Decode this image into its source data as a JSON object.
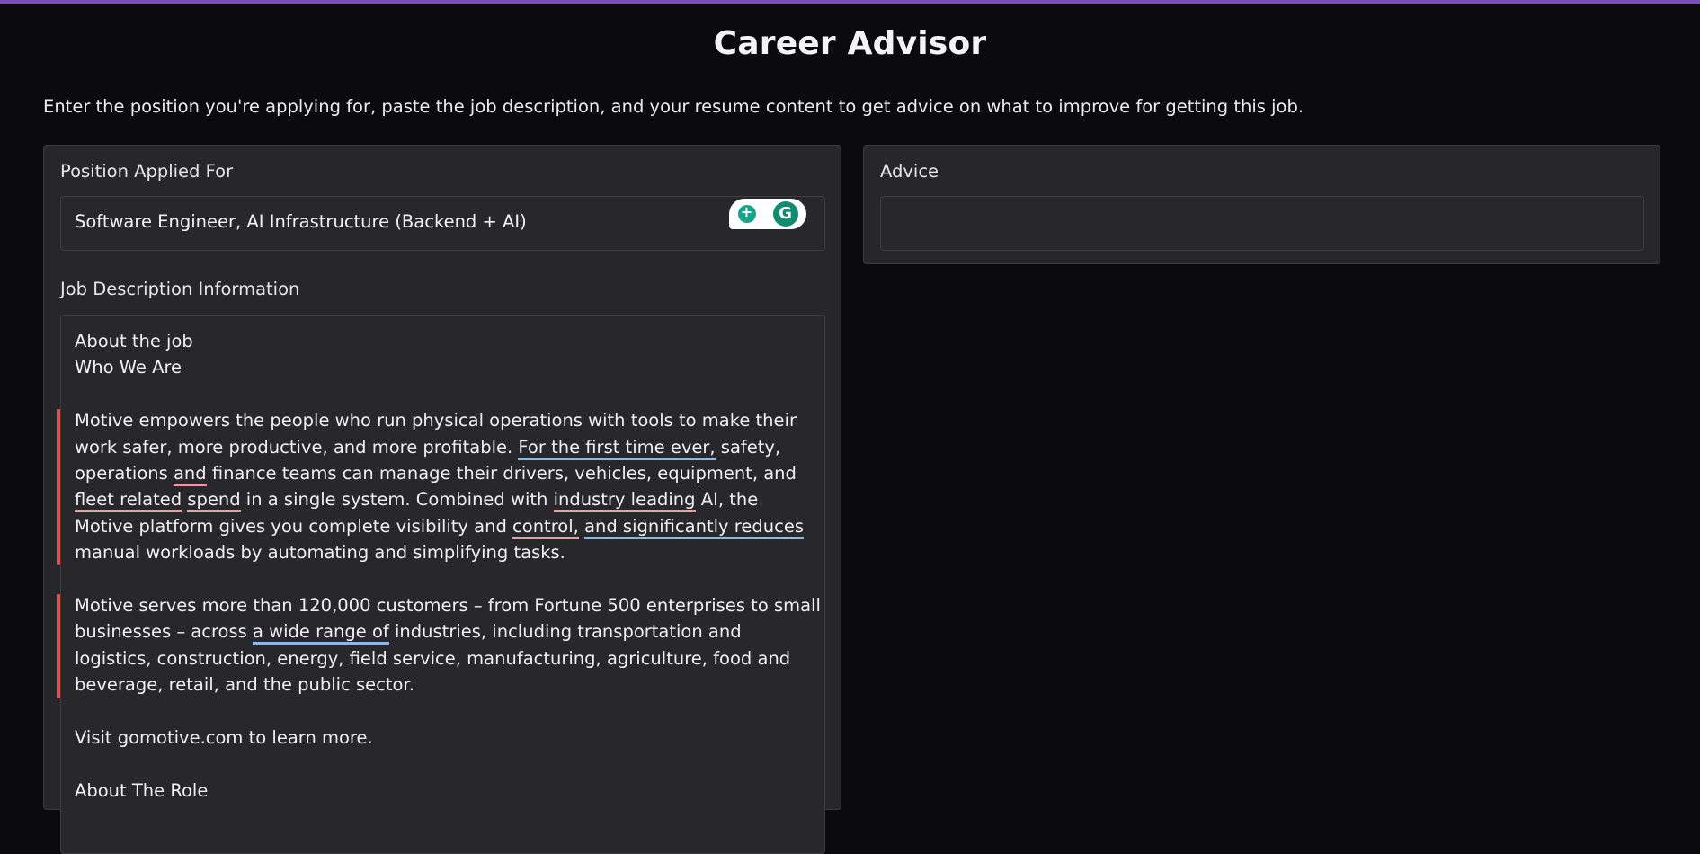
{
  "app": {
    "title": "Career Advisor"
  },
  "intro": "Enter the position you're applying for, paste the job description, and your resume content to get advice on what to improve for getting this job.",
  "position": {
    "label": "Position Applied For",
    "value": "Software Engineer, AI Infrastructure (Backend + AI)"
  },
  "job_description": {
    "label": "Job Description Information",
    "line1": "About the job",
    "line2": "Who We Are",
    "p1": {
      "a": "Motive empowers the people who run physical operations with tools to make their work safer, more productive, and more profitable. ",
      "b": "For the first time ever,",
      "c": " safety, operations ",
      "d": "and",
      "e": " finance teams can manage their drivers, vehicles, equipment, and ",
      "f": "fleet related",
      "g": " ",
      "h": "spend",
      "i": " in a single system. Combined with ",
      "j": "industry leading",
      "k": " AI, the Motive platform gives you complete visibility and ",
      "l": "control,",
      "m": " ",
      "n": "and significantly reduces",
      "o": " manual workloads by automating and simplifying tasks."
    },
    "p2": {
      "a": "Motive serves more than 120,000 customers – from Fortune 500 enterprises to small businesses – across ",
      "b": "a wide range of",
      "c": " industries, including transportation and logistics, construction, energy, field service, manufacturing, agriculture, food and beverage, retail, and the public sector."
    },
    "p3": "Visit gomotive.com to learn more.",
    "p4": "About The Role"
  },
  "advice": {
    "label": "Advice",
    "value": ""
  },
  "colors": {
    "accent": "#7c4dbd",
    "background": "#0b0b0f",
    "panel": "#26262b",
    "grammar_red": "#e05050",
    "underline_blue": "#8fb4ef",
    "underline_red": "#f09aa8"
  },
  "icons": [
    "grammarly-bulb-icon",
    "grammarly-logo-icon"
  ]
}
